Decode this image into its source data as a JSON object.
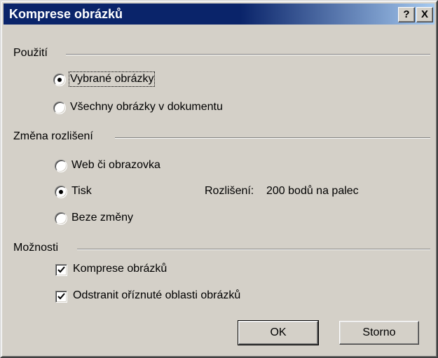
{
  "dialog": {
    "title": "Komprese obrázků",
    "help_button": "?",
    "close_button": "X"
  },
  "usage_group": {
    "label": "Použití",
    "options": [
      {
        "label": "Vybrané obrázky",
        "selected": true
      },
      {
        "label": "Všechny obrázky v dokumentu",
        "selected": false
      }
    ]
  },
  "resolution_group": {
    "label": "Změna rozlišení",
    "options": [
      {
        "label": "Web či obrazovka",
        "selected": false
      },
      {
        "label": "Tisk",
        "selected": true
      },
      {
        "label": "Beze změny",
        "selected": false
      }
    ],
    "info_label": "Rozlišení:",
    "info_value": "200 bodů na palec"
  },
  "options_group": {
    "label": "Možnosti",
    "checkboxes": [
      {
        "label": "Komprese obrázků",
        "checked": true
      },
      {
        "label": "Odstranit oříznuté oblasti obrázků",
        "checked": true
      }
    ]
  },
  "buttons": {
    "ok": "OK",
    "cancel": "Storno"
  }
}
